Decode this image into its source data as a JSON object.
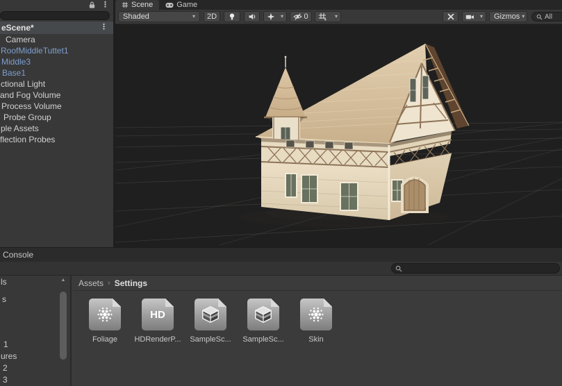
{
  "hierarchy": {
    "header": "eScene*",
    "items": [
      {
        "label": "Camera",
        "prefab": false
      },
      {
        "label": "RoofMiddleTuttet1",
        "prefab": true
      },
      {
        "label": "Middle3",
        "prefab": true
      },
      {
        "label": "Base1",
        "prefab": true
      },
      {
        "label": "ctional Light",
        "prefab": false
      },
      {
        "label": "and Fog Volume",
        "prefab": false
      },
      {
        "label": "Process Volume",
        "prefab": false
      },
      {
        "label": "Probe Group",
        "prefab": false
      },
      {
        "label": "ple Assets",
        "prefab": false
      },
      {
        "label": "flection Probes",
        "prefab": false
      }
    ]
  },
  "tabs": [
    {
      "label": "Scene"
    },
    {
      "label": "Game"
    }
  ],
  "scene_toolbar": {
    "shading": "Shaded",
    "mode_2d": "2D",
    "hidden_count": "0",
    "gizmos": "Gizmos",
    "search_placeholder": "All"
  },
  "console": {
    "tab_label": "Console"
  },
  "project": {
    "breadcrumb": {
      "root": "Assets",
      "separator": "›",
      "current": "Settings"
    },
    "tree_items": [
      "ls",
      "s",
      "1",
      "ures",
      "2",
      "3"
    ],
    "files": [
      {
        "name": "Foliage",
        "icon": "diffusion-profile-dots"
      },
      {
        "name": "HDRenderP...",
        "icon": "hd-render-pipeline",
        "icon_text": "HD"
      },
      {
        "name": "SampleSc...",
        "icon": "volume-profile-cube"
      },
      {
        "name": "SampleSc...",
        "icon": "volume-profile-cube"
      },
      {
        "name": "Skin",
        "icon": "diffusion-profile-dots"
      }
    ]
  },
  "icons": {
    "kebab": "⋮",
    "dropdown_arrow": "▾",
    "up_arrow": "▲"
  },
  "colors": {
    "panel_bg": "#383838",
    "dark_bar": "#2a2a2a",
    "prefab_blue": "#7f9fd0",
    "text": "#cfcfcf",
    "selected_header": "#46494c",
    "sky_top": "#7e8fab",
    "ground": "#96918b",
    "roof_tan": "#d8c3a3"
  }
}
